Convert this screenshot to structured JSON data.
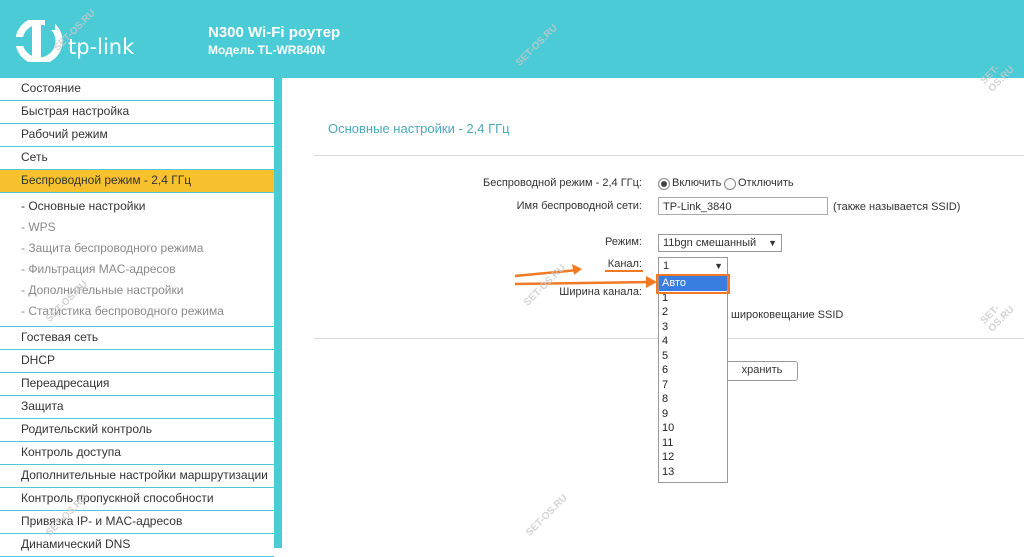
{
  "header": {
    "logo_text": "tp-link",
    "title": "N300 Wi-Fi роутер",
    "model": "Модель TL-WR840N"
  },
  "sidebar": {
    "items_top": [
      "Состояние",
      "Быстрая настройка",
      "Рабочий режим",
      "Сеть"
    ],
    "active": "Беспроводной режим - 2,4 ГГц",
    "sub_items": [
      "- Основные настройки",
      "- WPS",
      "- Защита беспроводного режима",
      "- Фильтрация MAC-адресов",
      "- Дополнительные настройки",
      "- Статистика беспроводного режима"
    ],
    "items_bottom": [
      "Гостевая сеть",
      "DHCP",
      "Переадресация",
      "Защита",
      "Родительский контроль",
      "Контроль доступа",
      "Дополнительные настройки маршрутизации",
      "Контроль пропускной способности",
      "Привязка IP- и MAC-адресов",
      "Динамический DNS"
    ]
  },
  "main": {
    "title": "Основные настройки - 2,4 ГГц",
    "wireless_label": "Беспроводной режим - 2,4 ГГц:",
    "enable_label": "Включить",
    "disable_label": "Отключить",
    "ssid_label": "Имя беспроводной сети:",
    "ssid_value": "TP-Link_3840",
    "ssid_hint": "(также называется SSID)",
    "mode_label": "Режим:",
    "mode_value": "11bgn смешанный",
    "channel_label": "Канал:",
    "channel_value": "1",
    "width_label": "Ширина канала:",
    "ssid_broadcast_partial": "широковещание SSID",
    "save_partial": "хранить"
  },
  "channel_dropdown": {
    "options": [
      "Авто",
      "1",
      "2",
      "3",
      "4",
      "5",
      "6",
      "7",
      "8",
      "9",
      "10",
      "11",
      "12",
      "13"
    ],
    "highlighted": "Авто"
  },
  "watermark": "SET-OS.RU",
  "colors": {
    "header": "#4acbd6",
    "active_nav": "#f6c12c",
    "annotation": "#f07a23",
    "selection": "#3a7de0"
  }
}
